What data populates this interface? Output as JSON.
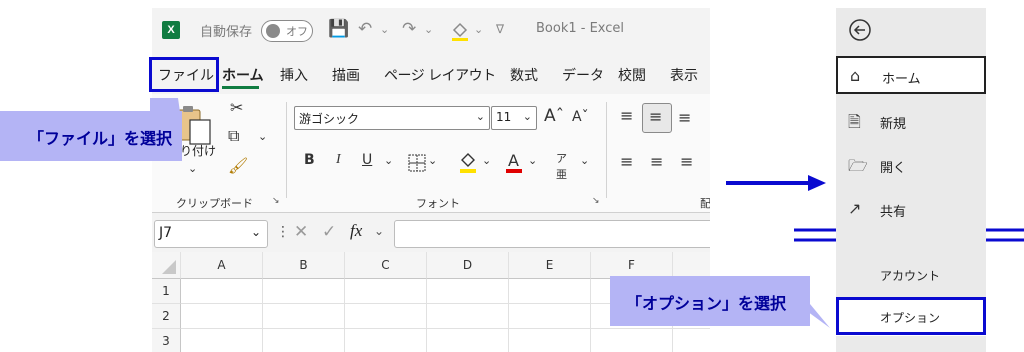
{
  "excel": {
    "titlebar": {
      "logo": "X",
      "autosave_label": "自動保存",
      "autosave_state": "オフ",
      "title": "Book1  -  Excel"
    },
    "menu": [
      "ファイル",
      "ホーム",
      "挿入",
      "描画",
      "ページ レイアウト",
      "数式",
      "データ",
      "校閲",
      "表示"
    ],
    "ribbon": {
      "paste_label": "貼り付け",
      "clipboard_label": "クリップボード",
      "font_name": "游ゴシック",
      "font_size": "11",
      "font_group_label": "フォント",
      "align_group_label_partial": "配"
    },
    "formula_bar": {
      "name_box": "J7",
      "fx_label": "fx"
    },
    "columns": [
      "A",
      "B",
      "C",
      "D",
      "E",
      "F"
    ],
    "rows": [
      "1",
      "2",
      "3"
    ]
  },
  "callouts": {
    "file": "「ファイル」を選択",
    "options": "「オプション」を選択"
  },
  "backstage": {
    "items": [
      "ホーム",
      "新規",
      "開く",
      "共有"
    ],
    "lower_items": [
      "アカウント",
      "オプション"
    ]
  },
  "colors": {
    "excel_green": "#107c41",
    "highlight_blue": "#0a0ad0",
    "callout_bg": "#b4b4f5",
    "callout_text": "#00009a"
  }
}
